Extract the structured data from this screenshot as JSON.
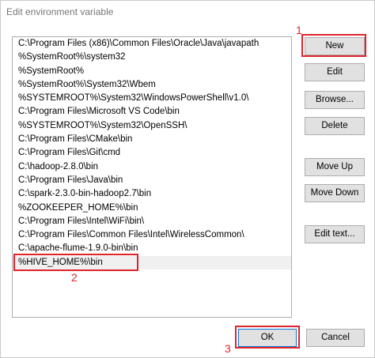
{
  "window": {
    "title": "Edit environment variable"
  },
  "list": {
    "items": [
      "C:\\Program Files (x86)\\Common Files\\Oracle\\Java\\javapath",
      "%SystemRoot%\\system32",
      "%SystemRoot%",
      "%SystemRoot%\\System32\\Wbem",
      "%SYSTEMROOT%\\System32\\WindowsPowerShell\\v1.0\\",
      "C:\\Program Files\\Microsoft VS Code\\bin",
      "%SYSTEMROOT%\\System32\\OpenSSH\\",
      "C:\\Program Files\\CMake\\bin",
      "C:\\Program Files\\Git\\cmd",
      "C:\\hadoop-2.8.0\\bin",
      "C:\\Program Files\\Java\\bin",
      "C:\\spark-2.3.0-bin-hadoop2.7\\bin",
      "%ZOOKEEPER_HOME%\\bin",
      "C:\\Program Files\\Intel\\WiFi\\bin\\",
      "C:\\Program Files\\Common Files\\Intel\\WirelessCommon\\",
      "C:\\apache-flume-1.9.0-bin\\bin",
      "%HIVE_HOME%\\bin"
    ],
    "selected_index": 16
  },
  "buttons": {
    "new": "New",
    "edit": "Edit",
    "browse": "Browse...",
    "delete": "Delete",
    "move_up": "Move Up",
    "move_down": "Move Down",
    "edit_text": "Edit text...",
    "ok": "OK",
    "cancel": "Cancel"
  },
  "annotations": {
    "step1": "1",
    "step2": "2",
    "step3": "3",
    "color": "#e0242c"
  }
}
